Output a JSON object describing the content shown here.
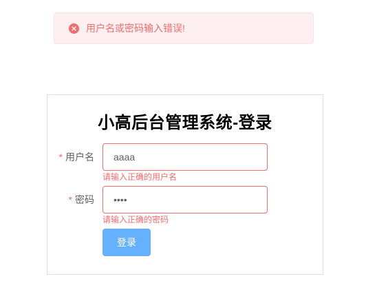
{
  "message": {
    "icon": "circle-close-icon",
    "text": "用户名或密码输入错误!",
    "color": "#f56c6c"
  },
  "login": {
    "title": "小高后台管理系统-登录",
    "username": {
      "required_mark": "*",
      "label": "用户名",
      "value": "aaaa",
      "error": "请输入正确的用户名"
    },
    "password": {
      "required_mark": "*",
      "label": "密码",
      "value": "••••",
      "error": "请输入正确的密码"
    },
    "submit_label": "登录",
    "button_color": "#66b1ff"
  }
}
